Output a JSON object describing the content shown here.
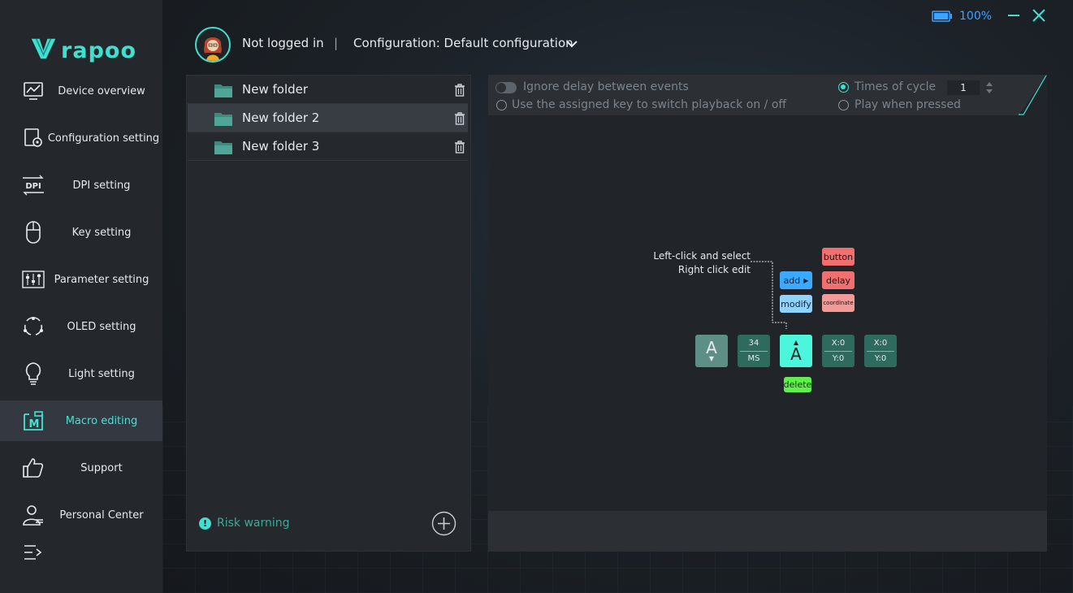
{
  "window": {
    "battery_pct": "100%",
    "minimize_icon": "minimize-icon",
    "close_icon": "close-icon"
  },
  "brand": {
    "logo_text": "rapoo",
    "accent": "#3fe0d0"
  },
  "header": {
    "user": "Not logged in",
    "separator": "|",
    "configuration": "Configuration: Default configuration"
  },
  "sidebar": {
    "items": [
      {
        "label": "Device overview",
        "icon": "monitor-chart-icon"
      },
      {
        "label": "Configuration setting",
        "icon": "config-gear-icon"
      },
      {
        "label": "DPI setting",
        "icon": "dpi-icon"
      },
      {
        "label": "Key setting",
        "icon": "mouse-icon"
      },
      {
        "label": "Parameter setting",
        "icon": "sliders-icon"
      },
      {
        "label": "OLED setting",
        "icon": "oled-icon"
      },
      {
        "label": "Light setting",
        "icon": "bulb-icon"
      },
      {
        "label": "Macro editing",
        "icon": "macro-icon",
        "active": true
      },
      {
        "label": "Support",
        "icon": "thumbs-up-icon"
      },
      {
        "label": "Personal Center",
        "icon": "user-icon"
      }
    ]
  },
  "folders": {
    "items": [
      {
        "name": "New folder"
      },
      {
        "name": "New folder 2",
        "selected": true
      },
      {
        "name": "New folder 3"
      }
    ],
    "risk_warning": "Risk warning"
  },
  "macro": {
    "options": {
      "ignore_delay": "Ignore delay between events",
      "assigned_key": "Use the assigned key to switch playback on / off",
      "times_of_cycle": "Times of cycle",
      "cycle_value": "1",
      "play_when_pressed": "Play when pressed"
    },
    "hint": {
      "line1": "Left-click and select",
      "line2": "Right click edit"
    },
    "legend": {
      "add": "add",
      "modify": "modify",
      "button": "button",
      "delay": "delay",
      "coordinate": "coordinate",
      "delete": "delete"
    },
    "events": [
      {
        "top": "A"
      },
      {
        "top": "34",
        "bottom": "MS"
      },
      {
        "top": "A"
      },
      {
        "top": "X:0",
        "bottom": "Y:0"
      },
      {
        "top": "X:0",
        "bottom": "Y:0"
      }
    ]
  }
}
